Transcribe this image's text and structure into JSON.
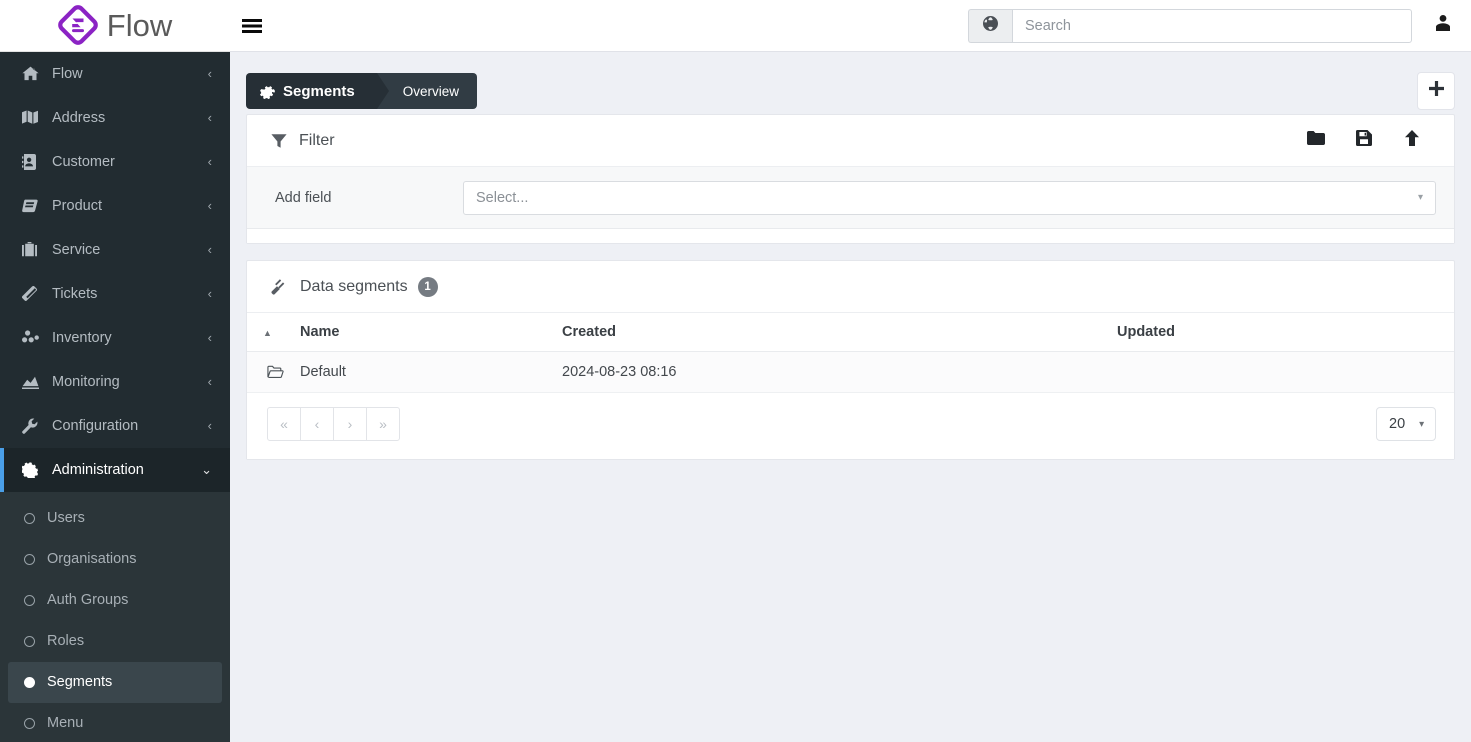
{
  "brand": {
    "name": "Flow",
    "logo_icon": "flow-diamond-logo",
    "accent_color": "#8b23c4"
  },
  "topbar": {
    "menu_toggle_icon": "hamburger-icon",
    "search": {
      "placeholder": "Search",
      "value": "",
      "addon_icon": "globe-icon"
    },
    "user_icon": "user-icon"
  },
  "sidebar": {
    "items": [
      {
        "label": "Flow",
        "icon": "home-icon",
        "chevron": "‹"
      },
      {
        "label": "Address",
        "icon": "map-icon",
        "chevron": "‹"
      },
      {
        "label": "Customer",
        "icon": "address-book-icon",
        "chevron": "‹"
      },
      {
        "label": "Product",
        "icon": "box-icon",
        "chevron": "‹"
      },
      {
        "label": "Service",
        "icon": "briefcase-icon",
        "chevron": "‹"
      },
      {
        "label": "Tickets",
        "icon": "ticket-icon",
        "chevron": "‹"
      },
      {
        "label": "Inventory",
        "icon": "boxes-icon",
        "chevron": "‹"
      },
      {
        "label": "Monitoring",
        "icon": "chart-area-icon",
        "chevron": "‹"
      },
      {
        "label": "Configuration",
        "icon": "wrench-icon",
        "chevron": "‹"
      },
      {
        "label": "Administration",
        "icon": "gear-icon",
        "chevron": "⌄",
        "active": true
      }
    ],
    "subitems": [
      {
        "label": "Users"
      },
      {
        "label": "Organisations"
      },
      {
        "label": "Auth Groups"
      },
      {
        "label": "Roles"
      },
      {
        "label": "Segments",
        "active": true
      },
      {
        "label": "Menu"
      }
    ]
  },
  "page": {
    "breadcrumb": {
      "primary": "Segments",
      "primary_icon": "gear-icon",
      "secondary": "Overview"
    },
    "add_button": {
      "label": "+",
      "icon": "plus-icon"
    }
  },
  "filter_panel": {
    "title": "Filter",
    "title_icon": "funnel-icon",
    "actions": [
      {
        "icon": "folder-icon",
        "name": "open-filter"
      },
      {
        "icon": "floppy-disk-icon",
        "name": "save-filter"
      },
      {
        "icon": "arrow-up-icon",
        "name": "upload-filter"
      }
    ],
    "add_field_label": "Add field",
    "add_field_placeholder": "Select...",
    "caret": "▾"
  },
  "segments_panel": {
    "title": "Data segments",
    "title_icon": "gavel-icon",
    "count": "1",
    "columns": [
      {
        "key": "sort",
        "label": "",
        "sort_indicator": "▲"
      },
      {
        "key": "name",
        "label": "Name"
      },
      {
        "key": "created",
        "label": "Created"
      },
      {
        "key": "updated",
        "label": "Updated"
      }
    ],
    "rows": [
      {
        "row_icon": "open-folder-icon",
        "name": "Default",
        "created": "2024-08-23 08:16",
        "updated": ""
      }
    ],
    "pagination": {
      "first": "«",
      "prev": "‹",
      "next": "›",
      "last": "»",
      "page_size": "20",
      "page_size_caret": "▾"
    }
  }
}
